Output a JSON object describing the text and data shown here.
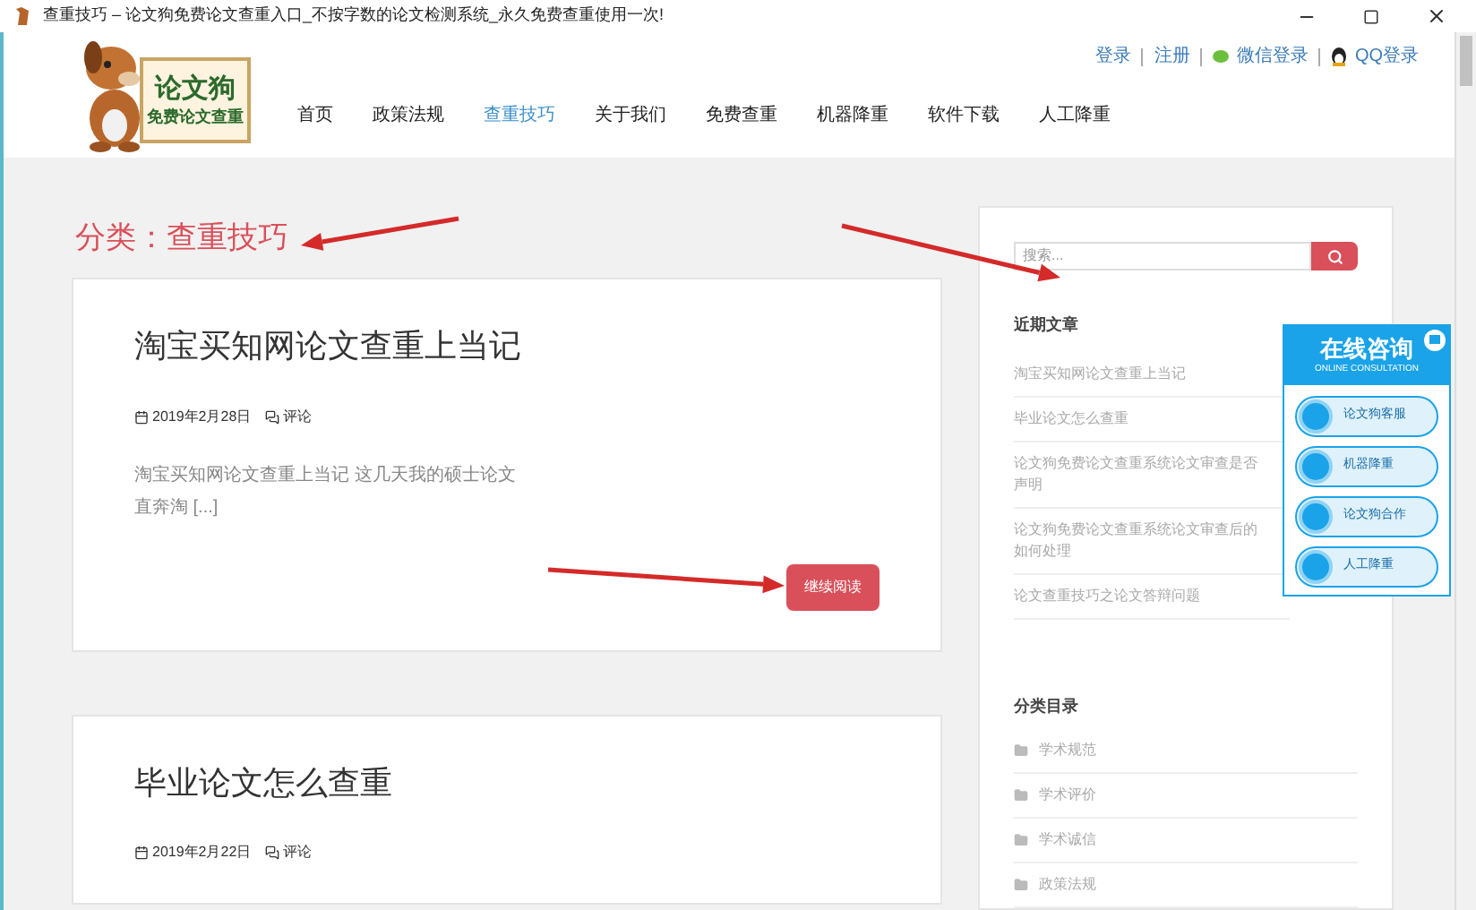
{
  "window": {
    "title": "查重技巧 – 论文狗免费论文查重入口_不按字数的论文检测系统_永久免费查重使用一次!"
  },
  "logo": {
    "title": "论文狗",
    "subtitle": "免费论文查重"
  },
  "top_links": [
    {
      "label": "登录",
      "kind": "plain"
    },
    {
      "label": "注册",
      "kind": "plain"
    },
    {
      "label": "微信登录",
      "kind": "wechat"
    },
    {
      "label": "QQ登录",
      "kind": "qq"
    }
  ],
  "nav": [
    {
      "label": "首页",
      "selected": false
    },
    {
      "label": "政策法规",
      "selected": false
    },
    {
      "label": "查重技巧",
      "selected": true
    },
    {
      "label": "关于我们",
      "selected": false
    },
    {
      "label": "免费查重",
      "selected": false
    },
    {
      "label": "机器降重",
      "selected": false
    },
    {
      "label": "软件下载",
      "selected": false
    },
    {
      "label": "人工降重",
      "selected": false
    }
  ],
  "category_heading": "分类：查重技巧",
  "posts": [
    {
      "title": "淘宝买知网论文查重上当记",
      "date": "2019年2月28日",
      "comments": "评论",
      "excerpt_lines": [
        "淘宝买知网论文查重上当记  这几天我的硕士论文",
        "直奔淘 [...]"
      ],
      "button": "继续阅读"
    },
    {
      "title": "毕业论文怎么查重",
      "date": "2019年2月22日",
      "comments": "评论"
    }
  ],
  "sidebar": {
    "search": {
      "placeholder": "搜索..."
    },
    "recent": {
      "title": "近期文章",
      "items": [
        [
          "淘宝买知网论文查重上当记"
        ],
        [
          "毕业论文怎么查重"
        ],
        [
          "论文狗免费论文查重系统论文审查是否",
          "声明"
        ],
        [
          "论文狗免费论文查重系统论文审查后的",
          "如何处理"
        ],
        [
          "论文查重技巧之论文答辩问题"
        ]
      ]
    },
    "categories": {
      "title": "分类目录",
      "items": [
        "学术规范",
        "学术评价",
        "学术诚信",
        "政策法规"
      ]
    }
  },
  "consult": {
    "title": "在线咨询",
    "subtitle": "ONLINE CONSULTATION",
    "buttons": [
      "论文狗客服",
      "机器降重",
      "论文狗合作",
      "人工降重"
    ]
  }
}
